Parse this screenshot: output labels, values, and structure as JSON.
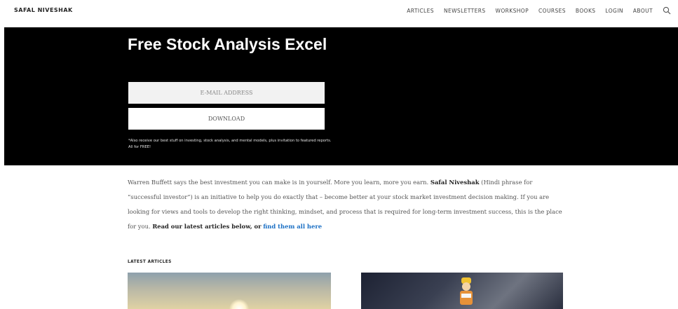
{
  "nav": {
    "brand": "SAFAL NIVESHAK",
    "items": [
      "ARTICLES",
      "NEWSLETTERS",
      "WORKSHOP",
      "COURSES",
      "BOOKS",
      "LOGIN",
      "ABOUT"
    ],
    "search_icon": "search-icon"
  },
  "hero": {
    "title": "Free Stock Analysis Excel",
    "email_placeholder": "E-MAIL ADDRESS",
    "button_label": "DOWNLOAD",
    "note": "*Also receive our best stuff on investing, stock analysis, and mental models, plus invitation to featured reports. All for FREE!"
  },
  "intro": {
    "text_1": "Warren Buffett says the best investment you can make is in yourself. More you learn, more you earn.",
    "brand": "Safal Niveshak",
    "text_2": "(Hindi phrase for “successful investor”) is an initiative to help you do exactly that – become better at your stock market investment decision making. If you are looking for views and tools to develop the right thinking, mindset, and process that is required for long-term investment success, this is the place for you.",
    "cta_text": "Read our latest articles below, or",
    "link_text": "find them all here"
  },
  "latest": {
    "label": "LATEST ARTICLES"
  },
  "colors": {
    "hero_bg": "#000000",
    "link": "#1a6fc4"
  }
}
